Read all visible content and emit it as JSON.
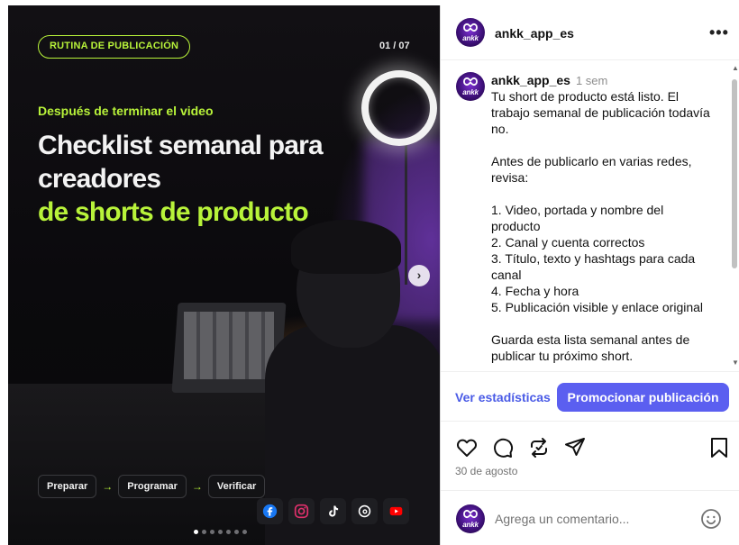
{
  "post": {
    "badge": "RUTINA DE PUBLICACIÓN",
    "counter": "01 / 07",
    "kicker": "Después de terminar el video",
    "headline_line1": "Checklist semanal para",
    "headline_line2": "creadores",
    "headline_line3": "de shorts de producto",
    "steps": [
      "Preparar",
      "Programar",
      "Verificar"
    ],
    "step_arrow": "→",
    "next_icon": "chevron-right-icon",
    "socials": [
      "facebook-icon",
      "instagram-icon",
      "tiktok-icon",
      "threads-icon",
      "youtube-icon"
    ],
    "dots_total": 7,
    "dots_active": 1,
    "accent": "#b8f33a"
  },
  "header": {
    "avatar_text": "ankk",
    "username": "ankk_app_es",
    "more_label": "•••"
  },
  "comment": {
    "username": "ankk_app_es",
    "time": "1 sem",
    "lines": [
      "Tu short de producto está listo. El",
      "trabajo semanal de publicación todavía",
      "no.",
      "",
      "Antes de publicarlo en varias redes,",
      "revisa:",
      "",
      "1. Video, portada y nombre del",
      "producto",
      "2. Canal y cuenta correctos",
      "3. Título, texto y hashtags para cada",
      "canal",
      "4. Fecha y hora",
      "5. Publicación visible y enlace original",
      "",
      "Guarda esta lista semanal antes de",
      "publicar tu próximo short."
    ]
  },
  "actions": {
    "stats_link": "Ver estadísticas",
    "promote_button": "Promocionar publicación",
    "promote_color": "#5b5ff0",
    "icons": [
      "heart-icon",
      "comment-icon",
      "repost-icon",
      "share-icon",
      "bookmark-icon"
    ]
  },
  "date": "30 de agosto",
  "add_comment": {
    "placeholder": "Agrega un comentario...",
    "emoji_icon": "emoji-icon"
  }
}
